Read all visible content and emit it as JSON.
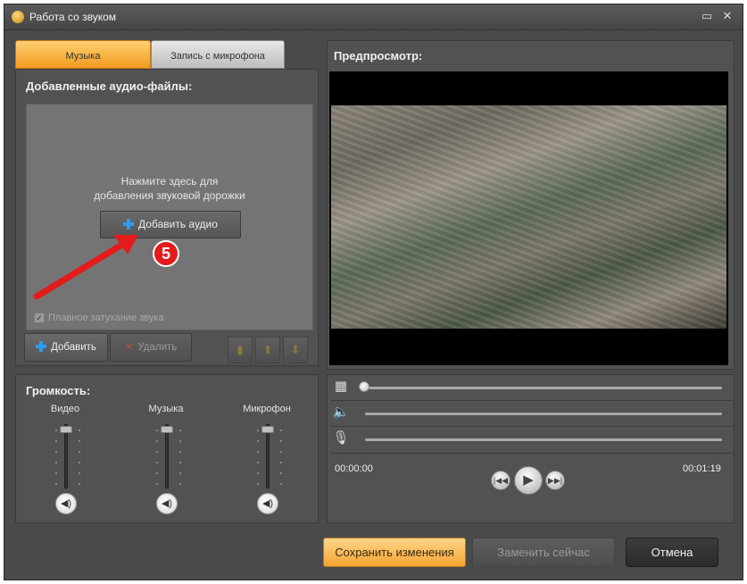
{
  "window": {
    "title": "Работа со звуком",
    "minimize_glyph": "▭",
    "close_glyph": "✕"
  },
  "tabs": [
    {
      "label": "Музыка",
      "active": true
    },
    {
      "label": "Запись с микрофона",
      "active": false
    }
  ],
  "audio_files": {
    "section_label": "Добавленные аудио-файлы:",
    "hint_line1": "Нажмите здесь для",
    "hint_line2": "добавления звуковой дорожки",
    "add_audio_label": "Добавить аудио",
    "step_badge": "5",
    "fade_checkbox_label": "Плавное затухание звука",
    "fade_checked": true,
    "add_button_label": "Добавить",
    "delete_button_label": "Удалить"
  },
  "volume": {
    "section_label": "Громкость:",
    "channels": [
      {
        "label": "Видео"
      },
      {
        "label": "Музыка"
      },
      {
        "label": "Микрофон"
      }
    ]
  },
  "preview": {
    "section_label": "Предпросмотр:"
  },
  "playback": {
    "current_time": "00:00:00",
    "total_time": "00:01:19"
  },
  "actions": {
    "save_label": "Сохранить изменения",
    "replace_label": "Заменить сейчас",
    "cancel_label": "Отмена"
  },
  "icons": [
    "app-icon",
    "minimize-icon",
    "close-icon",
    "plus-icon",
    "delete-x-icon",
    "bookmark-icon",
    "arrow-up-icon",
    "arrow-down-icon",
    "speaker-icon",
    "film-icon",
    "microphone-icon",
    "prev-icon",
    "play-icon",
    "next-icon"
  ],
  "colors": {
    "accent_orange": "#f39b1e",
    "window_bg": "#4a4a4a",
    "arrow_red": "#e31b1b"
  }
}
